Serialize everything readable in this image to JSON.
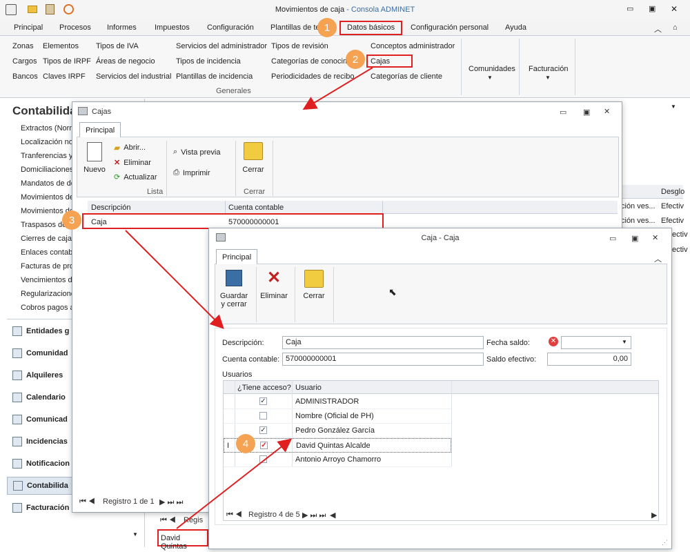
{
  "app": {
    "title": "Movimientos de caja",
    "subtitle": "- Consola ADMINET"
  },
  "menu": [
    "Principal",
    "Procesos",
    "Informes",
    "Impuestos",
    "Configuración",
    "Plantillas de te",
    "Datos básicos",
    "Configuración personal",
    "Ayuda"
  ],
  "ribbon": {
    "col1": [
      "Zonas",
      "Cargos",
      "Bancos"
    ],
    "col2": [
      "Elementos",
      "Tipos de IRPF",
      "Claves IRPF"
    ],
    "col3": [
      "Tipos de IVA",
      "Áreas de negocio",
      "Servicios del industrial"
    ],
    "col4": [
      "Servicios del administrador",
      "Tipos de incidencia",
      "Plantillas de incidencia"
    ],
    "col5": [
      "Tipos de revisión",
      "Categorías de conocim",
      "Periodicidades de recibo"
    ],
    "col6": [
      "Conceptos administrador",
      "Cajas",
      "Categorías de cliente"
    ],
    "group_label": "Generales",
    "comunidades": "Comunidades",
    "facturacion": "Facturación"
  },
  "badges": [
    "1",
    "2",
    "3",
    "4"
  ],
  "left_panel": {
    "title": "Contabilida",
    "items": [
      "Extractos (Norm",
      "Localización nor",
      "Tranferencias y",
      "Domiciliaciones",
      "Mandatos de de",
      "Movimientos de",
      "Movimientos de",
      "Traspasos de",
      "Cierres de caja",
      "Enlaces contab",
      "Facturas de pro",
      "Vencimientos de",
      "Regularizacione",
      "Cobros pagos a"
    ],
    "nav": [
      "Entidades g",
      "Comunidad",
      "Alquileres",
      "Calendario",
      "Comunicad",
      "Incidencias",
      "Notificacion",
      "Contabilida",
      "Facturación"
    ]
  },
  "bg_grid": {
    "col_header": "Desglo",
    "rows": [
      [
        "ción ves...",
        "Efectiv"
      ],
      [
        "ción ves...",
        "Efectiv"
      ],
      [
        "",
        "ectiv"
      ],
      [
        "",
        "ectiv"
      ]
    ],
    "footer_record": "Regis",
    "footer_user": "David Quintas"
  },
  "cajas_window": {
    "title": "Cajas",
    "tab": "Principal",
    "nuevo": "Nuevo",
    "abrir": "Abrir...",
    "eliminar": "Eliminar",
    "actualizar": "Actualizar",
    "vista_previa": "Vista previa",
    "imprimir": "Imprimir",
    "cerrar": "Cerrar",
    "group_lista": "Lista",
    "group_cerrar": "Cerrar",
    "col_descripcion": "Descripción",
    "col_cuenta": "Cuenta contable",
    "row_descripcion": "Caja",
    "row_cuenta": "570000000001",
    "pager": "Registro 1 de 1"
  },
  "caja_window": {
    "title": "Caja - Caja",
    "tab": "Principal",
    "guardar": "Guardar",
    "guardar2": "y cerrar",
    "eliminar": "Eliminar",
    "cerrar": "Cerrar",
    "lbl_descripcion": "Descripción:",
    "val_descripcion": "Caja",
    "lbl_cuenta": "Cuenta contable:",
    "val_cuenta": "570000000001",
    "lbl_fecha": "Fecha saldo:",
    "val_fecha": "",
    "lbl_saldo": "Saldo efectivo:",
    "val_saldo": "0,00",
    "lbl_usuarios": "Usuarios",
    "col_acceso": "¿Tiene acceso?",
    "col_usuario": "Usuario",
    "users": [
      {
        "name": "ADMINISTRADOR",
        "access": "✓"
      },
      {
        "name": "Nombre (Oficial de PH)",
        "access": ""
      },
      {
        "name": "Pedro González García",
        "access": "✓"
      },
      {
        "name": "David Quintas Alcalde",
        "access": "✓"
      },
      {
        "name": "Antonio Arroyo Chamorro",
        "access": ""
      }
    ],
    "pager": "Registro 4 de 5"
  },
  "colors": {
    "accent": "#e02020",
    "badge": "#f5a252",
    "title_blue": "#3a6ea5"
  }
}
